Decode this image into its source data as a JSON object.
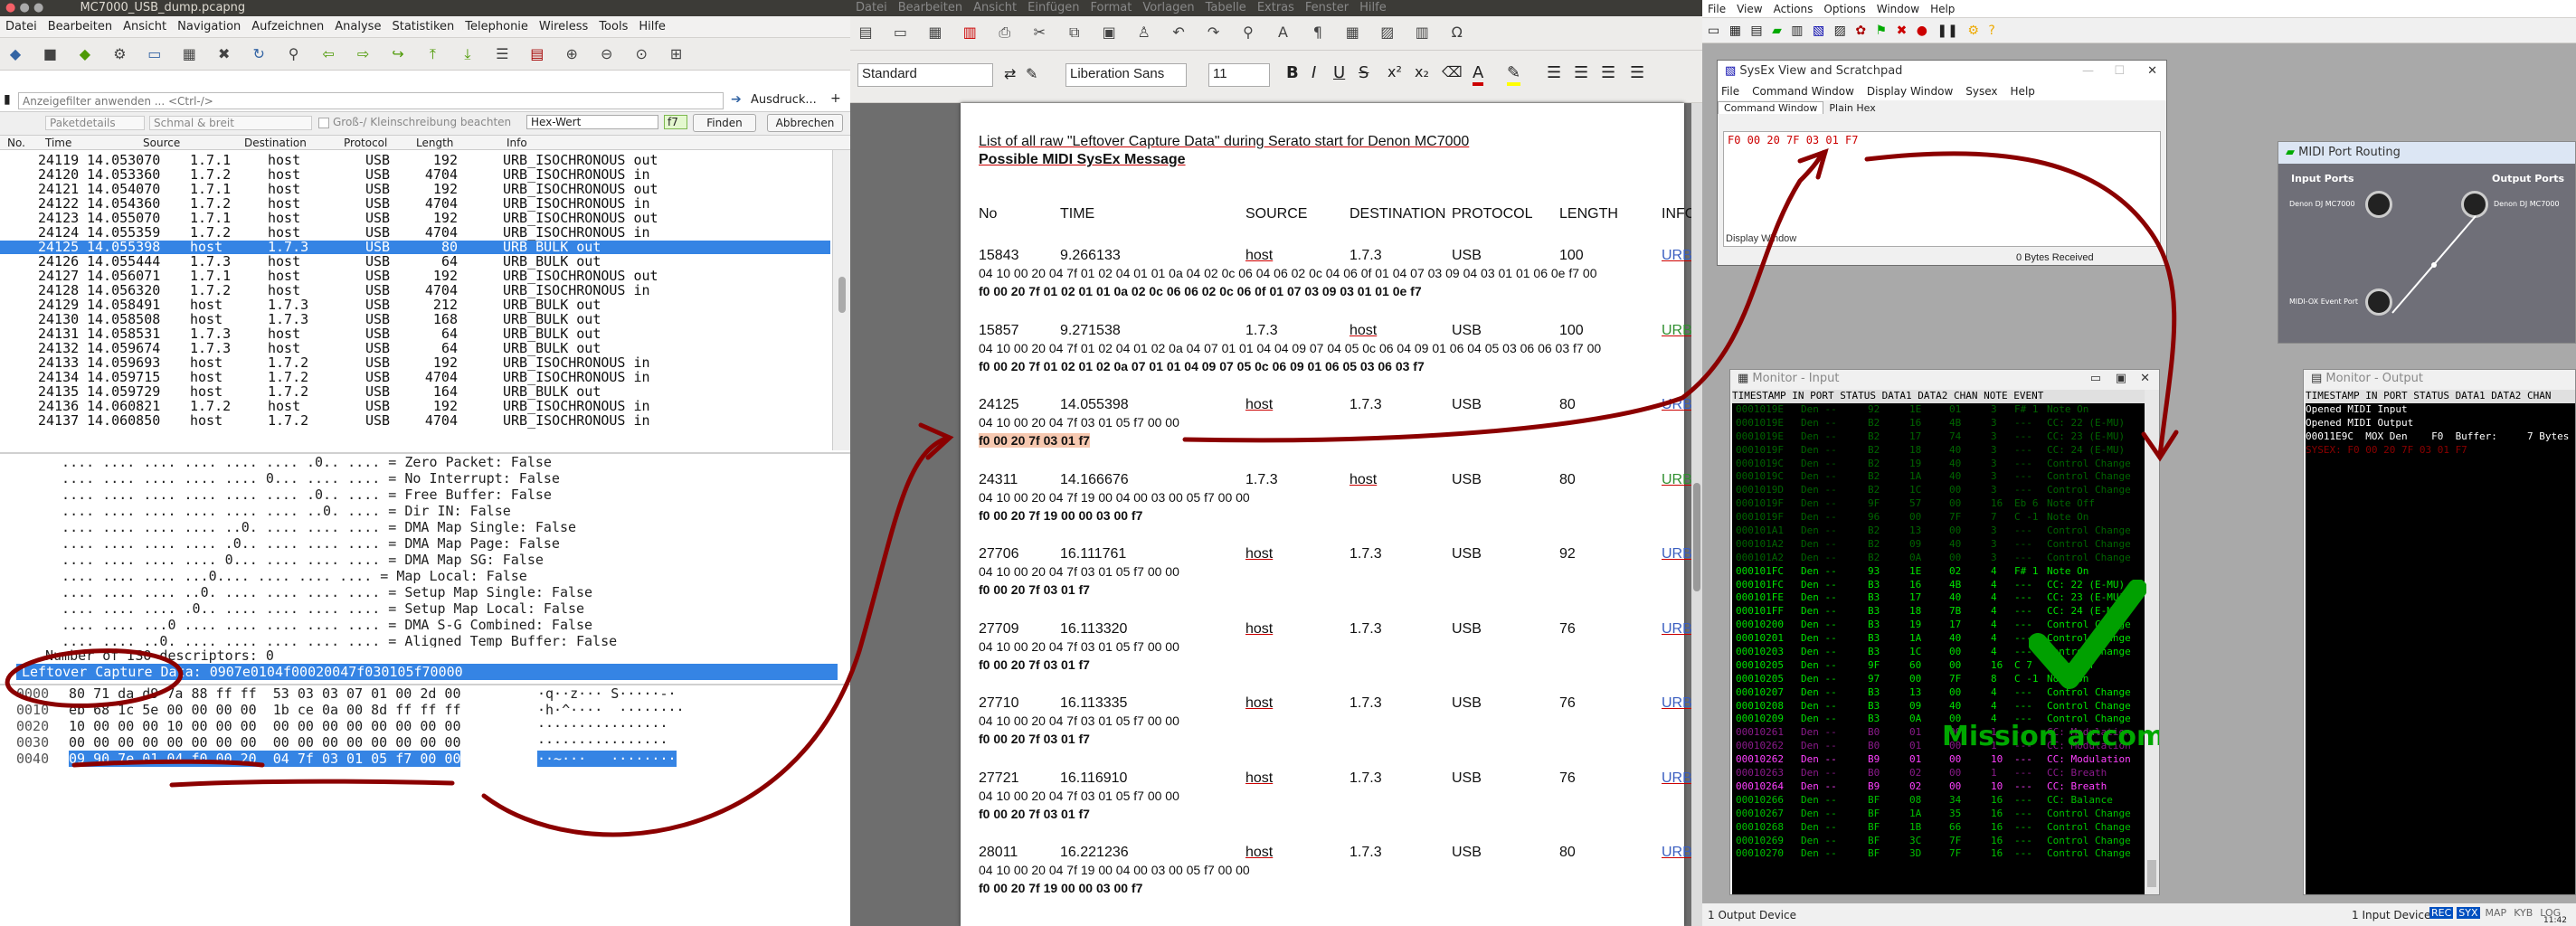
{
  "wireshark": {
    "title": "MC7000_USB_dump.pcapng",
    "menu": [
      "Datei",
      "Bearbeiten",
      "Ansicht",
      "Navigation",
      "Aufzeichnen",
      "Analyse",
      "Statistiken",
      "Telephonie",
      "Wireless",
      "Tools",
      "Hilfe"
    ],
    "filter_placeholder": "Anzeigefilter anwenden ... <Ctrl-/>",
    "expression_label": "Ausdruck...",
    "search": {
      "details_label": "Paketdetails",
      "width_label": "Schmal & breit",
      "case_label": "Groß-/ Kleinschreibung beachten",
      "type_value": "Hex-Wert",
      "query": "f7",
      "find_button": "Finden",
      "cancel_button": "Abbrechen"
    },
    "columns": [
      "No.",
      "Time",
      "Source",
      "Destination",
      "Protocol",
      "Length",
      "Info"
    ],
    "packets": [
      {
        "no": "24119",
        "time": "14.053070",
        "src": "1.7.1",
        "dst": "host",
        "proto": "USB",
        "len": "192",
        "info": "URB_ISOCHRONOUS out"
      },
      {
        "no": "24120",
        "time": "14.053360",
        "src": "1.7.2",
        "dst": "host",
        "proto": "USB",
        "len": "4704",
        "info": "URB_ISOCHRONOUS in"
      },
      {
        "no": "24121",
        "time": "14.054070",
        "src": "1.7.1",
        "dst": "host",
        "proto": "USB",
        "len": "192",
        "info": "URB_ISOCHRONOUS out"
      },
      {
        "no": "24122",
        "time": "14.054360",
        "src": "1.7.2",
        "dst": "host",
        "proto": "USB",
        "len": "4704",
        "info": "URB_ISOCHRONOUS in"
      },
      {
        "no": "24123",
        "time": "14.055070",
        "src": "1.7.1",
        "dst": "host",
        "proto": "USB",
        "len": "192",
        "info": "URB_ISOCHRONOUS out"
      },
      {
        "no": "24124",
        "time": "14.055359",
        "src": "1.7.2",
        "dst": "host",
        "proto": "USB",
        "len": "4704",
        "info": "URB_ISOCHRONOUS in"
      },
      {
        "no": "24125",
        "time": "14.055398",
        "src": "host",
        "dst": "1.7.3",
        "proto": "USB",
        "len": "80",
        "info": "URB_BULK out",
        "selected": true
      },
      {
        "no": "24126",
        "time": "14.055444",
        "src": "1.7.3",
        "dst": "host",
        "proto": "USB",
        "len": "64",
        "info": "URB_BULK out"
      },
      {
        "no": "24127",
        "time": "14.056071",
        "src": "1.7.1",
        "dst": "host",
        "proto": "USB",
        "len": "192",
        "info": "URB_ISOCHRONOUS out"
      },
      {
        "no": "24128",
        "time": "14.056320",
        "src": "1.7.2",
        "dst": "host",
        "proto": "USB",
        "len": "4704",
        "info": "URB_ISOCHRONOUS in"
      },
      {
        "no": "24129",
        "time": "14.058491",
        "src": "host",
        "dst": "1.7.3",
        "proto": "USB",
        "len": "212",
        "info": "URB_BULK out"
      },
      {
        "no": "24130",
        "time": "14.058508",
        "src": "host",
        "dst": "1.7.3",
        "proto": "USB",
        "len": "168",
        "info": "URB_BULK out"
      },
      {
        "no": "24131",
        "time": "14.058531",
        "src": "1.7.3",
        "dst": "host",
        "proto": "USB",
        "len": "64",
        "info": "URB_BULK out"
      },
      {
        "no": "24132",
        "time": "14.059674",
        "src": "1.7.3",
        "dst": "host",
        "proto": "USB",
        "len": "64",
        "info": "URB_BULK out"
      },
      {
        "no": "24133",
        "time": "14.059693",
        "src": "host",
        "dst": "1.7.2",
        "proto": "USB",
        "len": "192",
        "info": "URB_ISOCHRONOUS in"
      },
      {
        "no": "24134",
        "time": "14.059715",
        "src": "host",
        "dst": "1.7.2",
        "proto": "USB",
        "len": "4704",
        "info": "URB_ISOCHRONOUS in"
      },
      {
        "no": "24135",
        "time": "14.059729",
        "src": "host",
        "dst": "1.7.2",
        "proto": "USB",
        "len": "164",
        "info": "URB_BULK out"
      },
      {
        "no": "24136",
        "time": "14.060821",
        "src": "1.7.2",
        "dst": "host",
        "proto": "USB",
        "len": "192",
        "info": "URB_ISOCHRONOUS in"
      },
      {
        "no": "24137",
        "time": "14.060850",
        "src": "host",
        "dst": "1.7.2",
        "proto": "USB",
        "len": "4704",
        "info": "URB_ISOCHRONOUS in"
      }
    ],
    "details": [
      "  .... .... .... .... .... .... .0.. .... = Zero Packet: False",
      "  .... .... .... .... .... 0... .... .... = No Interrupt: False",
      "  .... .... .... .... .... .... .0.. .... = Free Buffer: False",
      "  .... .... .... .... .... .... ..0. .... = Dir IN: False",
      "  .... .... .... .... ..0. .... .... .... = DMA Map Single: False",
      "  .... .... .... .... .0.. .... .... .... = DMA Map Page: False",
      "  .... .... .... .... 0... .... .... .... = DMA Map SG: False",
      "  .... .... .... ...0.... .... .... .... = Map Local: False",
      "  .... .... .... ..0. .... .... .... .... = Setup Map Single: False",
      "  .... .... .... .0.. .... .... .... .... = Setup Map Local: False",
      "  .... .... ...0 .... .... .... .... .... = DMA S-G Combined: False",
      "  .... .... ..0. .... .... .... .... .... = Aligned Temp Buffer: False"
    ],
    "iso_descriptors": "Number of ISO descriptors: 0",
    "leftover_line": "Leftover Capture Data: 0907e0104f00020047f030105f70000",
    "hex_rows": [
      {
        "off": "0000",
        "hex": "80 71 da d9 7a 88 ff ff  53 03 03 07 01 00 2d 00",
        "ascii": "·q··z··· S·····-·"
      },
      {
        "off": "0010",
        "hex": "eb 68 1c 5e 00 00 00 00  1b ce 0a 00 8d ff ff ff",
        "ascii": "·h·^····  ········"
      },
      {
        "off": "0020",
        "hex": "10 00 00 00 10 00 00 00  00 00 00 00 00 00 00 00",
        "ascii": "················"
      },
      {
        "off": "0030",
        "hex": "00 00 00 00 00 00 00 00  00 00 00 00 00 00 00 00",
        "ascii": "················"
      },
      {
        "off": "0040",
        "hex": "09 90 7e 01 04 f0 00 20  04 7f 03 01 05 f7 00 00",
        "ascii": "··~···   ········"
      }
    ]
  },
  "writer": {
    "menu": [
      "Datei",
      "Bearbeiten",
      "Ansicht",
      "Einfügen",
      "Format",
      "Vorlagen",
      "Tabelle",
      "Extras",
      "Fenster",
      "Hilfe"
    ],
    "style_value": "Standard",
    "font_value": "Liberation Sans",
    "size_value": "11",
    "heading1": "List of all raw \"Leftover Capture Data\" during Serato start for Denon MC7000",
    "heading2": "Possible MIDI SysEx Message",
    "columns": [
      "No",
      "TIME",
      "SOURCE",
      "DESTINATION",
      "PROTOCOL",
      "LENGTH",
      "INFO"
    ],
    "entries": [
      {
        "no": "15843",
        "time": "9.266133",
        "src": "host",
        "dst": "1.7.3",
        "proto": "USB",
        "len": "100",
        "info": "URB_BULK out",
        "raw": "04 10 00 20 04 7f 01 02 04 01 01 0a 04 02 0c 06 04 06 02 0c 04 06 0f 01 04 07 03 09 04 03 01 01 06 0e f7 00",
        "sysex": "f0 00 20 7f 01 02 01 01 0a 02 0c 06 06 02 0c 06 0f 01 07 03 09 03 01 01 0e f7",
        "hl": false
      },
      {
        "no": "15857",
        "time": "9.271538",
        "src": "1.7.3",
        "dst": "host",
        "proto": "USB",
        "len": "100",
        "info": "URB_BULK in",
        "raw": "04 10 00 20 04 7f 01 02 04 01 02 0a 04 07 01 01 04 04 09 07 04 05 0c 06 04 09 01 06 04 05 03 06 06 03 f7 00",
        "sysex": "f0 00 20 7f 01 02 01 02 0a 07 01 01 04 09 07 05 0c 06 09 01 06 05 03 06 03 f7",
        "hl": false
      },
      {
        "no": "24125",
        "time": "14.055398",
        "src": "host",
        "dst": "1.7.3",
        "proto": "USB",
        "len": "80",
        "info": "URB_BULK out",
        "raw": "04 10 00 20 04 7f 03 01 05 f7 00 00",
        "sysex": "f0 00 20 7f 03 01 f7",
        "hl": true
      },
      {
        "no": "24311",
        "time": "14.166676",
        "src": "1.7.3",
        "dst": "host",
        "proto": "USB",
        "len": "80",
        "info": "URB_BULK in",
        "raw": "04 10 00 20 04 7f 19 00 04 00 03 00 05 f7 00 00",
        "sysex": "f0 00 20 7f 19 00 00 03 00 f7",
        "hl": false
      },
      {
        "no": "27706",
        "time": "16.111761",
        "src": "host",
        "dst": "1.7.3",
        "proto": "USB",
        "len": "92",
        "info": "URB_BULK out",
        "raw": "04 10 00 20 04 7f 03 01 05 f7 00 00",
        "sysex": "f0 00 20 7f 03 01 f7",
        "hl": false
      },
      {
        "no": "27709",
        "time": "16.113320",
        "src": "host",
        "dst": "1.7.3",
        "proto": "USB",
        "len": "76",
        "info": "URB_BULK out",
        "raw": "04 10 00 20 04 7f 03 01 05 f7 00 00",
        "sysex": "f0 00 20 7f 03 01 f7",
        "hl": false
      },
      {
        "no": "27710",
        "time": "16.113335",
        "src": "host",
        "dst": "1.7.3",
        "proto": "USB",
        "len": "76",
        "info": "URB_BULK out",
        "raw": "04 10 00 20 04 7f 03 01 05 f7 00 00",
        "sysex": "f0 00 20 7f 03 01 f7",
        "hl": false
      },
      {
        "no": "27721",
        "time": "16.116910",
        "src": "host",
        "dst": "1.7.3",
        "proto": "USB",
        "len": "76",
        "info": "URB_BULK out",
        "raw": "04 10 00 20 04 7f 03 01 05 f7 00 00",
        "sysex": "f0 00 20 7f 03 01 f7",
        "hl": false
      },
      {
        "no": "28011",
        "time": "16.221236",
        "src": "host",
        "dst": "1.7.3",
        "proto": "USB",
        "len": "80",
        "info": "URB_BULK out",
        "raw": "04 10 00 20 04 7f 19 00 04 00 03 00 05 f7 00 00",
        "sysex": "f0 00 20 7f 19 00 00 03 00 f7",
        "hl": false
      }
    ]
  },
  "midiox": {
    "menu": [
      "File",
      "View",
      "Actions",
      "Options",
      "Window",
      "Help"
    ],
    "sysex": {
      "title": "SysEx View and Scratchpad",
      "menu": [
        "File",
        "Command Window",
        "Display Window",
        "Sysex",
        "Help"
      ],
      "tabs": [
        "Command Window",
        "Plain Hex"
      ],
      "command": "F0 00 20 7F 03 01 F7",
      "display_label": "Display Window",
      "bytes_received": "0 Bytes Received"
    },
    "routing": {
      "title": "MIDI Port Routing",
      "input_label": "Input Ports",
      "output_label": "Output Ports",
      "input_ports": [
        "Denon DJ MC7000",
        "MIDI-OX Event Port"
      ],
      "output_ports": [
        "Denon DJ MC7000"
      ]
    },
    "monitor_in": {
      "title": "Monitor - Input",
      "header": "TIMESTAMP IN PORT STATUS DATA1 DATA2 CHAN NOTE EVENT",
      "rows": [
        {
          "t": "0001019E",
          "s": "92",
          "d1": "1E",
          "d2": "01",
          "ch": "3",
          "n": "F# 1",
          "e": "Note On",
          "c": "#006400"
        },
        {
          "t": "0001019E",
          "s": "B2",
          "d1": "16",
          "d2": "4B",
          "ch": "3",
          "n": "---",
          "e": "CC: 22 (E-MU)",
          "c": "#006400"
        },
        {
          "t": "0001019E",
          "s": "B2",
          "d1": "17",
          "d2": "74",
          "ch": "3",
          "n": "---",
          "e": "CC: 23 (E-MU)",
          "c": "#006400"
        },
        {
          "t": "0001019F",
          "s": "B2",
          "d1": "18",
          "d2": "40",
          "ch": "3",
          "n": "---",
          "e": "CC: 24 (E-MU)",
          "c": "#006400"
        },
        {
          "t": "0001019C",
          "s": "B2",
          "d1": "19",
          "d2": "40",
          "ch": "3",
          "n": "---",
          "e": "Control Change",
          "c": "#006400"
        },
        {
          "t": "0001019C",
          "s": "B2",
          "d1": "1A",
          "d2": "40",
          "ch": "3",
          "n": "---",
          "e": "Control Change",
          "c": "#006400"
        },
        {
          "t": "0001019D",
          "s": "B2",
          "d1": "1C",
          "d2": "00",
          "ch": "3",
          "n": "---",
          "e": "Control Change",
          "c": "#006400"
        },
        {
          "t": "0001019F",
          "s": "9F",
          "d1": "57",
          "d2": "00",
          "ch": "16",
          "n": "Eb 6",
          "e": "Note Off",
          "c": "#006400"
        },
        {
          "t": "0001019F",
          "s": "96",
          "d1": "00",
          "d2": "7F",
          "ch": "7",
          "n": "C -1",
          "e": "Note On",
          "c": "#006400"
        },
        {
          "t": "000101A1",
          "s": "B2",
          "d1": "13",
          "d2": "00",
          "ch": "3",
          "n": "---",
          "e": "Control Change",
          "c": "#006400"
        },
        {
          "t": "000101A2",
          "s": "B2",
          "d1": "09",
          "d2": "40",
          "ch": "3",
          "n": "---",
          "e": "Control Change",
          "c": "#006400"
        },
        {
          "t": "000101A2",
          "s": "B2",
          "d1": "0A",
          "d2": "00",
          "ch": "3",
          "n": "---",
          "e": "Control Change",
          "c": "#006400"
        },
        {
          "t": "000101FC",
          "s": "93",
          "d1": "1E",
          "d2": "02",
          "ch": "4",
          "n": "F# 1",
          "e": "Note On",
          "c": "#00e000"
        },
        {
          "t": "000101FC",
          "s": "B3",
          "d1": "16",
          "d2": "4B",
          "ch": "4",
          "n": "---",
          "e": "CC: 22 (E-MU)",
          "c": "#00e000"
        },
        {
          "t": "000101FE",
          "s": "B3",
          "d1": "17",
          "d2": "40",
          "ch": "4",
          "n": "---",
          "e": "CC: 23 (E-MU)",
          "c": "#00e000"
        },
        {
          "t": "000101FF",
          "s": "B3",
          "d1": "18",
          "d2": "7B",
          "ch": "4",
          "n": "---",
          "e": "CC: 24 (E-MU)",
          "c": "#00e000"
        },
        {
          "t": "00010200",
          "s": "B3",
          "d1": "19",
          "d2": "17",
          "ch": "4",
          "n": "---",
          "e": "Control Change",
          "c": "#00e000"
        },
        {
          "t": "00010201",
          "s": "B3",
          "d1": "1A",
          "d2": "40",
          "ch": "4",
          "n": "---",
          "e": "Control Change",
          "c": "#00e000"
        },
        {
          "t": "00010203",
          "s": "B3",
          "d1": "1C",
          "d2": "00",
          "ch": "4",
          "n": "---",
          "e": "Control Change",
          "c": "#00e000"
        },
        {
          "t": "00010205",
          "s": "9F",
          "d1": "60",
          "d2": "00",
          "ch": "16",
          "n": "C 7",
          "e": "Note Off",
          "c": "#00e000"
        },
        {
          "t": "00010205",
          "s": "97",
          "d1": "00",
          "d2": "7F",
          "ch": "8",
          "n": "C -1",
          "e": "Note On",
          "c": "#00e000"
        },
        {
          "t": "00010207",
          "s": "B3",
          "d1": "13",
          "d2": "00",
          "ch": "4",
          "n": "---",
          "e": "Control Change",
          "c": "#00e000"
        },
        {
          "t": "00010208",
          "s": "B3",
          "d1": "09",
          "d2": "40",
          "ch": "4",
          "n": "---",
          "e": "Control Change",
          "c": "#00e000"
        },
        {
          "t": "00010209",
          "s": "B3",
          "d1": "0A",
          "d2": "00",
          "ch": "4",
          "n": "---",
          "e": "Control Change",
          "c": "#00e000"
        },
        {
          "t": "00010261",
          "s": "B0",
          "d1": "01",
          "d2": "00",
          "ch": "1",
          "n": "---",
          "e": "CC: Modulation",
          "c": "#8b1a8b"
        },
        {
          "t": "00010262",
          "s": "B0",
          "d1": "01",
          "d2": "00",
          "ch": "1",
          "n": "---",
          "e": "CC: Modulation",
          "c": "#8b1a8b"
        },
        {
          "t": "00010262",
          "s": "B9",
          "d1": "01",
          "d2": "00",
          "ch": "10",
          "n": "---",
          "e": "CC: Modulation",
          "c": "#ff40ff"
        },
        {
          "t": "00010263",
          "s": "B0",
          "d1": "02",
          "d2": "00",
          "ch": "1",
          "n": "---",
          "e": "CC: Breath",
          "c": "#8b1a8b"
        },
        {
          "t": "00010264",
          "s": "B9",
          "d1": "02",
          "d2": "00",
          "ch": "10",
          "n": "---",
          "e": "CC: Breath",
          "c": "#ff40ff"
        },
        {
          "t": "00010266",
          "s": "BF",
          "d1": "08",
          "d2": "34",
          "ch": "16",
          "n": "---",
          "e": "CC: Balance",
          "c": "#00c000"
        },
        {
          "t": "00010267",
          "s": "BF",
          "d1": "1A",
          "d2": "35",
          "ch": "16",
          "n": "---",
          "e": "Control Change",
          "c": "#00c000"
        },
        {
          "t": "00010268",
          "s": "BF",
          "d1": "1B",
          "d2": "66",
          "ch": "16",
          "n": "---",
          "e": "Control Change",
          "c": "#00c000"
        },
        {
          "t": "00010269",
          "s": "BF",
          "d1": "3C",
          "d2": "7F",
          "ch": "16",
          "n": "---",
          "e": "Control Change",
          "c": "#00c000"
        },
        {
          "t": "00010270",
          "s": "BF",
          "d1": "3D",
          "d2": "7F",
          "ch": "16",
          "n": "---",
          "e": "Control Change",
          "c": "#00c000"
        }
      ]
    },
    "monitor_out": {
      "title": "Monitor - Output",
      "header": "TIMESTAMP IN PORT STATUS DATA1 DATA2 CHAN",
      "lines": [
        "Opened MIDI Input",
        "Opened MIDI Output",
        "00011E9C  MOX Den    F0  Buffer:     7 Bytes",
        "SYSEX: F0 00 20 7F 03 01 F7"
      ]
    },
    "mission_text": "Mission accomplished",
    "status_left": "1 Output Device",
    "status_right": "1 Input Device",
    "status_badges": [
      "REC",
      "SYX",
      "MAP",
      "KYB",
      "LOG"
    ],
    "clock": "11:42"
  }
}
